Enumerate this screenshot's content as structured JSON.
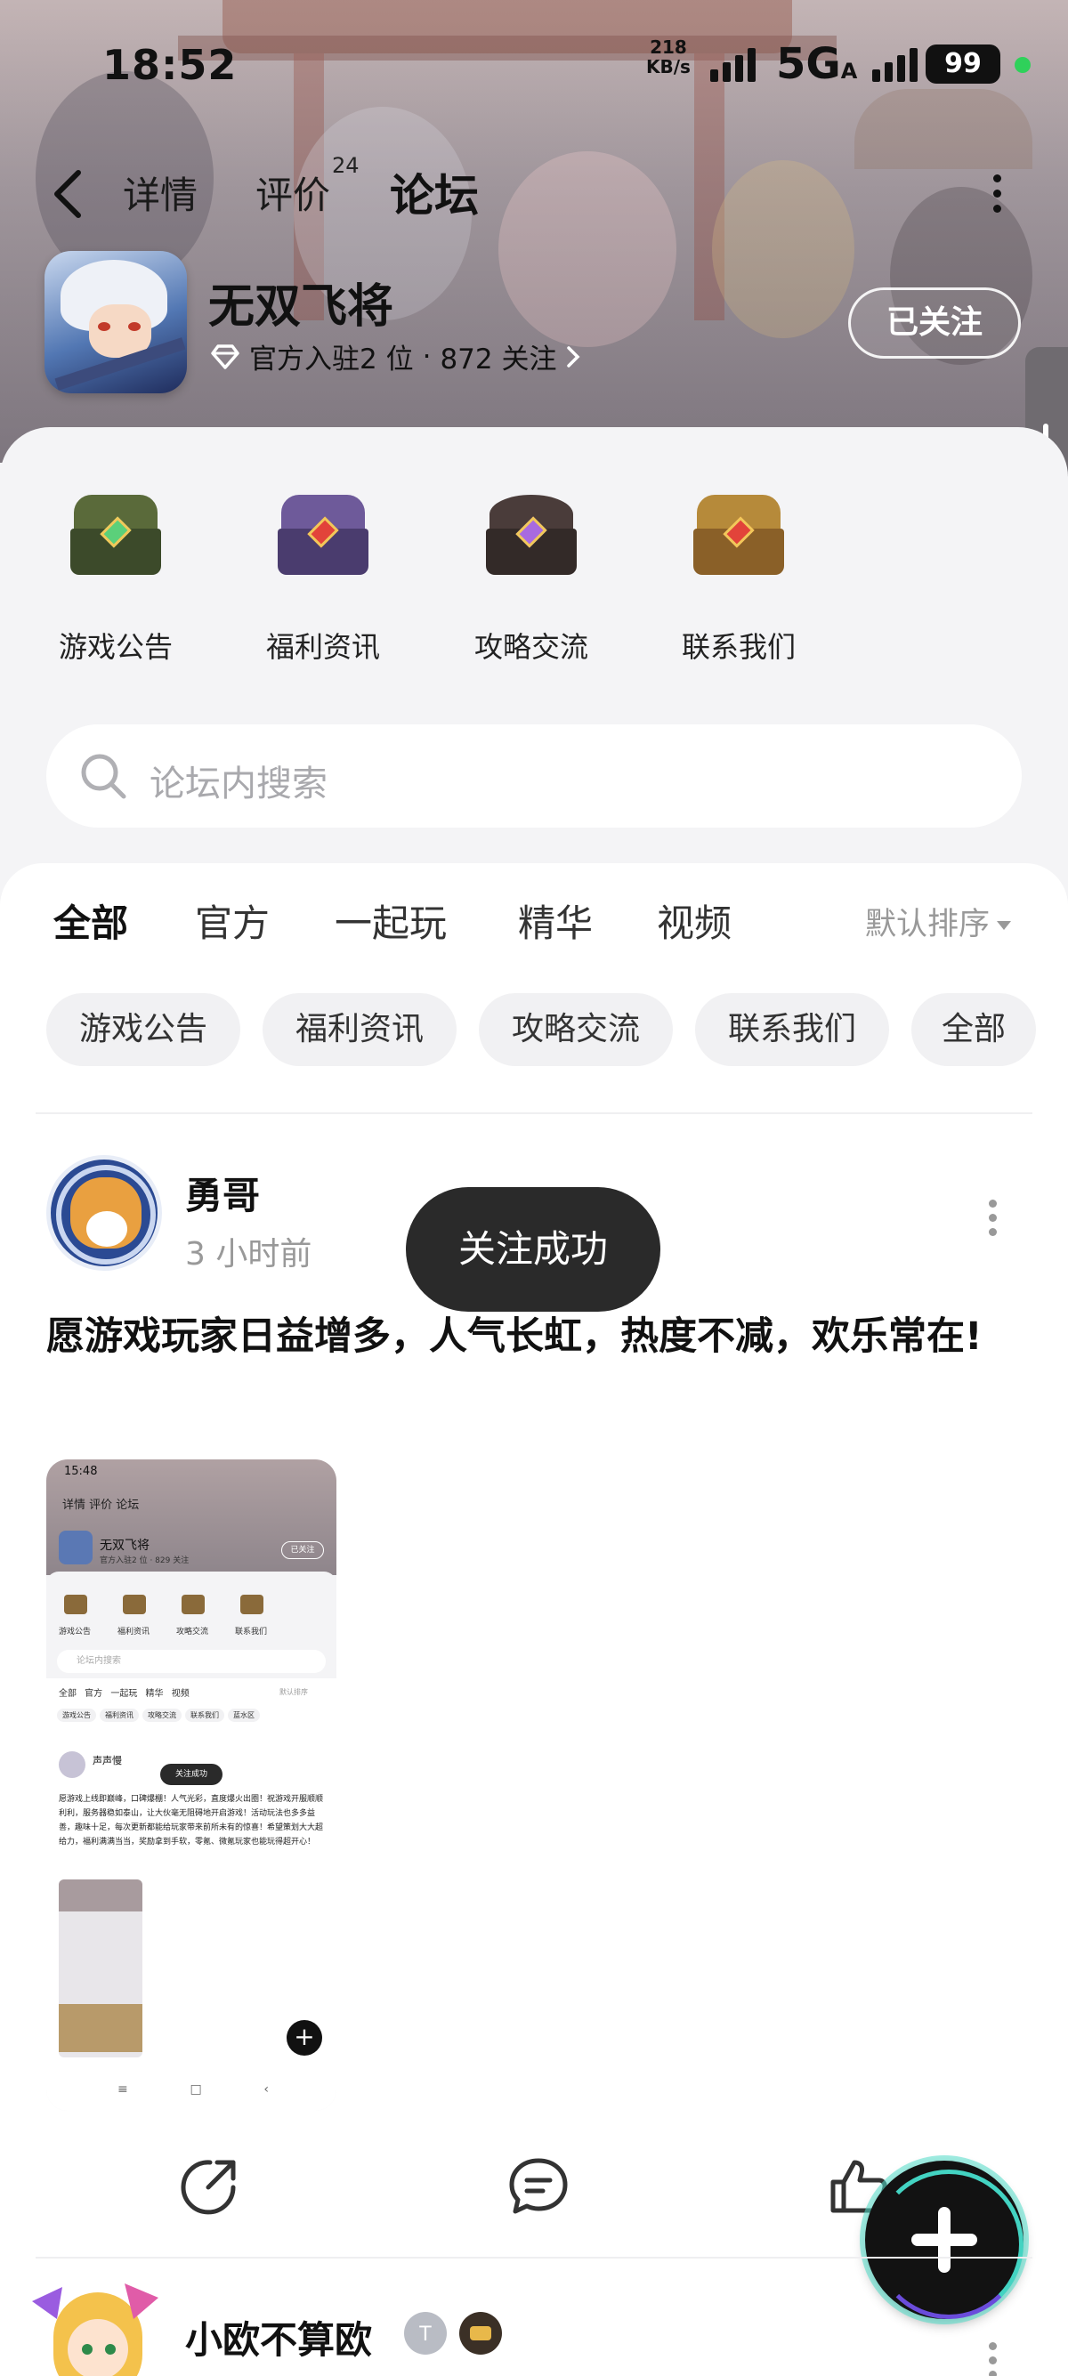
{
  "status_bar": {
    "time": "18:52",
    "net_speed_value": "218",
    "net_speed_unit": "KB/s",
    "network": "5G",
    "network_sub": "A",
    "battery": "99"
  },
  "nav": {
    "tabs": [
      {
        "label": "详情"
      },
      {
        "label": "评价",
        "count": "24"
      },
      {
        "label": "论坛"
      }
    ],
    "active_tab": "论坛"
  },
  "game": {
    "title": "无双飞将",
    "meta_rank": "官方入驻2 位",
    "meta_sep": "·",
    "meta_followers": "872 关注",
    "follow_button": "已关注"
  },
  "categories": [
    {
      "label": "游戏公告",
      "icon": "chest-green-icon"
    },
    {
      "label": "福利资讯",
      "icon": "chest-purple-icon"
    },
    {
      "label": "攻略交流",
      "icon": "chest-dark-icon"
    },
    {
      "label": "联系我们",
      "icon": "chest-gold-icon"
    }
  ],
  "search": {
    "placeholder": "论坛内搜索"
  },
  "filter_tabs": [
    "全部",
    "官方",
    "一起玩",
    "精华",
    "视频"
  ],
  "sort_label": "默认排序",
  "chips": [
    "游戏公告",
    "福利资讯",
    "攻略交流",
    "联系我们",
    "全部"
  ],
  "post": {
    "author": "勇哥",
    "time": "3 小时前",
    "text": "愿游戏玩家日益增多，人气长虹，热度不减，欢乐常在!",
    "toast": "关注成功"
  },
  "thumbnail": {
    "time": "15:48",
    "nav": "详情  评价  论坛",
    "title": "无双飞将",
    "sub": "官方入驻2 位 · 829 关注",
    "follow": "已关注",
    "cats": [
      "游戏公告",
      "福利资讯",
      "攻略交流",
      "联系我们"
    ],
    "search": "论坛内搜索",
    "tabs": "全部 官方 一起玩 精华 视频",
    "sort": "默认排序",
    "chips": [
      "游戏公告",
      "福利资讯",
      "攻略交流",
      "联系我们",
      "蓝水区"
    ],
    "author": "声声慢",
    "toast": "关注成功",
    "text": "愿游戏上线即巅峰，口碑爆棚！人气光彩，直度爆火出圈！祝游戏开服顺顺利利，服务器稳如泰山，让大伙毫无阻碍地开启游戏！活动玩法也多多益善，趣味十足，每次更新都能给玩家带来前所未有的惊喜！希望策划大大超给力，福利满满当当，奖励拿到手软，零氪、微氪玩家也能玩得超开心！",
    "fab": "+",
    "navbar": [
      "≡",
      "□",
      "‹"
    ]
  },
  "second_post": {
    "author": "小欧不算欧"
  },
  "colors": {
    "accent": "#3fd6c4",
    "fab_ring": "#43d3c2",
    "toast_bg": "#2a2a2a",
    "status_dot": "#2fd15a"
  }
}
